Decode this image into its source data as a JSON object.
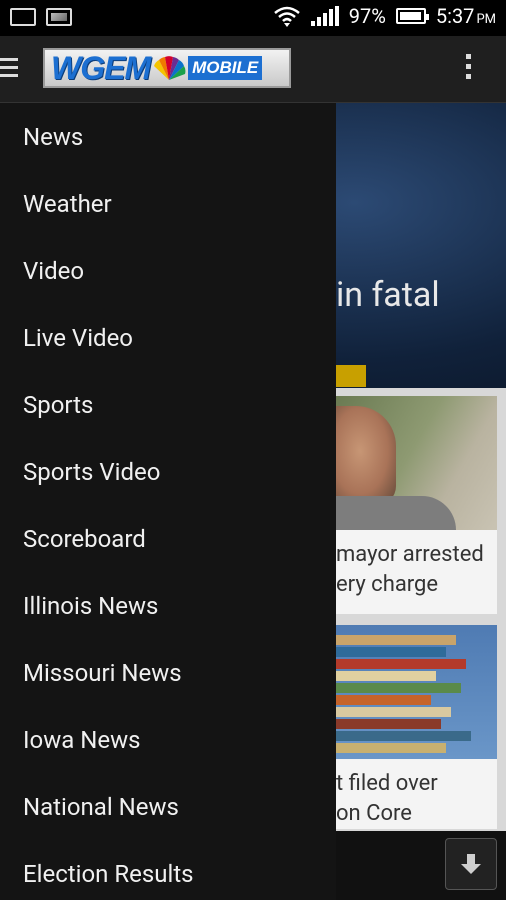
{
  "status_bar": {
    "battery_percent": "97%",
    "battery_level": 0.97,
    "time": "5:37",
    "ampm": "PM"
  },
  "app_bar": {
    "logo_text": "WGEM",
    "logo_suffix": "MOBILE"
  },
  "background": {
    "hero_title": "in fatal",
    "cards": [
      {
        "line1": "mayor arrested",
        "line2": "ery charge"
      },
      {
        "line1": "t filed over",
        "line2": "on Core"
      }
    ]
  },
  "drawer": {
    "items": [
      "News",
      "Weather",
      "Video",
      "Live Video",
      "Sports",
      "Sports Video",
      "Scoreboard",
      "Illinois News",
      "Missouri News",
      "Iowa News",
      "National News",
      "Election Results"
    ]
  }
}
